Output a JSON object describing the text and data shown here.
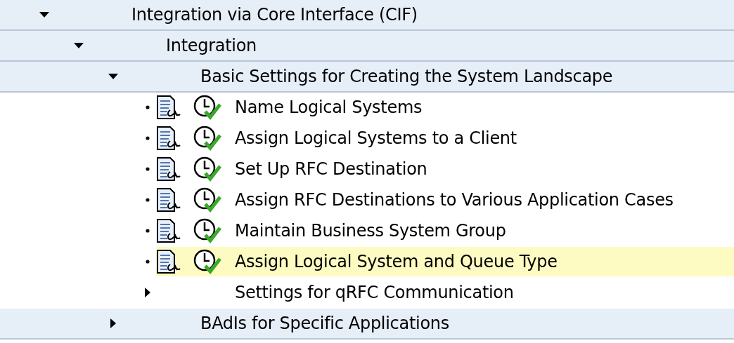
{
  "tree": [
    {
      "kind": "folder",
      "label": "Integration via Core Interface (CIF)",
      "expanded": true,
      "children": [
        {
          "kind": "folder",
          "label": "Integration",
          "expanded": true,
          "children": [
            {
              "kind": "folder",
              "label": "Basic Settings for Creating the System Landscape",
              "expanded": true,
              "children": [
                {
                  "kind": "activity",
                  "label": "Name Logical Systems",
                  "selected": false
                },
                {
                  "kind": "activity",
                  "label": "Assign Logical Systems to a Client",
                  "selected": false
                },
                {
                  "kind": "activity",
                  "label": "Set Up RFC Destination",
                  "selected": false
                },
                {
                  "kind": "activity",
                  "label": "Assign RFC Destinations to Various Application Cases",
                  "selected": false
                },
                {
                  "kind": "activity",
                  "label": "Maintain Business System Group",
                  "selected": false
                },
                {
                  "kind": "activity",
                  "label": "Assign Logical System and Queue Type",
                  "selected": true
                },
                {
                  "kind": "folder",
                  "label": "Settings for qRFC Communication",
                  "expanded": false
                }
              ]
            },
            {
              "kind": "folder",
              "label": "BAdIs for Specific Applications",
              "expanded": false
            }
          ]
        }
      ]
    }
  ]
}
